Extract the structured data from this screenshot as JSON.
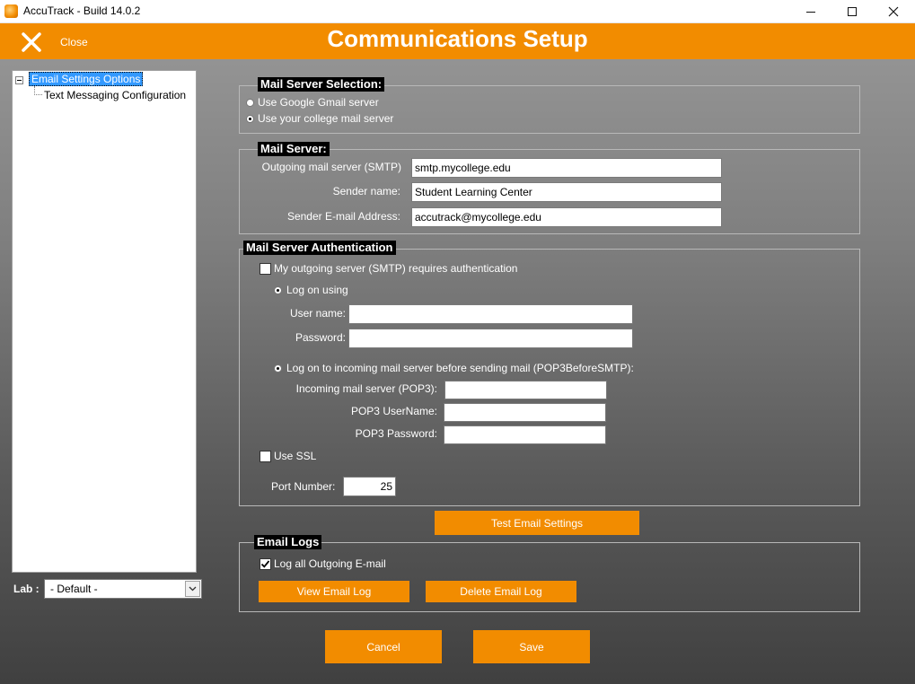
{
  "window": {
    "title": "AccuTrack - Build 14.0.2"
  },
  "header": {
    "close_label": "Close",
    "title": "Communications Setup"
  },
  "tree": {
    "items": [
      "Email Settings Options",
      "Text Messaging Configuration"
    ]
  },
  "lab": {
    "label": "Lab :",
    "value": "- Default -"
  },
  "mail_server_selection": {
    "legend": "Mail Server Selection:",
    "options": [
      "Use Google Gmail server",
      "Use your college mail server"
    ],
    "selected": "Use your college mail server"
  },
  "mail_server": {
    "legend": "Mail Server:",
    "smtp_label": "Outgoing mail server (SMTP)",
    "smtp_value": "smtp.mycollege.edu",
    "sender_name_label": "Sender name:",
    "sender_name_value": "Student Learning Center",
    "sender_email_label": "Sender E-mail Address:",
    "sender_email_value": "accutrack@mycollege.edu"
  },
  "authentication": {
    "legend": "Mail Server Authentication",
    "requires_auth_label": "My outgoing server (SMTP) requires authentication",
    "requires_auth_checked": false,
    "logon_using_label": "Log on using",
    "username_label": "User name:",
    "username_value": "",
    "password_label": "Password:",
    "password_value": "",
    "pop3_option_label": "Log on to incoming mail server before sending mail (POP3BeforeSMTP):",
    "pop3_server_label": "Incoming mail server (POP3):",
    "pop3_server_value": "",
    "pop3_username_label": "POP3 UserName:",
    "pop3_username_value": "",
    "pop3_password_label": "POP3 Password:",
    "pop3_password_value": "",
    "use_ssl_label": "Use SSL",
    "use_ssl_checked": false,
    "port_label": "Port Number:",
    "port_value": "25"
  },
  "test_button": "Test Email Settings",
  "email_logs": {
    "legend": "Email Logs",
    "log_all_label": "Log all Outgoing E-mail",
    "log_all_checked": true,
    "view_button": "View Email Log",
    "delete_button": "Delete Email Log"
  },
  "footer": {
    "cancel": "Cancel",
    "save": "Save"
  },
  "colors": {
    "accent": "#f28c00",
    "selection": "#3399ff"
  }
}
